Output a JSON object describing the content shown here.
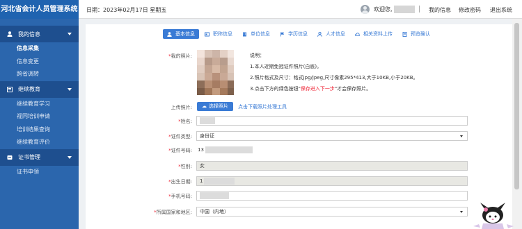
{
  "header": {
    "app_title": "河北省会计人员管理系统",
    "date_label": "日期：2023年02月17日 星期五",
    "welcome": "欢迎您,",
    "links": {
      "my_info": "我的信息",
      "change_password": "修改密码",
      "logout": "退出系统"
    }
  },
  "sidebar": {
    "groups": [
      {
        "label": "我的信息",
        "items": [
          "信息采集",
          "信息变更",
          "跨省调转"
        ]
      },
      {
        "label": "继续教育",
        "items": [
          "继续教育学习",
          "视同培训申请",
          "培训结果查询",
          "继续教育评价"
        ]
      },
      {
        "label": "证书管理",
        "items": [
          "证书申领"
        ]
      }
    ],
    "active_item": "信息采集"
  },
  "tabs": [
    "基本信息",
    "职称信息",
    "单位信息",
    "学历信息",
    "人才信息",
    "相关资料上传",
    "预览确认"
  ],
  "form": {
    "required_mark": "*",
    "photo_label": "我的照片:",
    "notes": {
      "title": "说明：",
      "line1": "1.本人近期免冠证件照片(白底)。",
      "line2": "2.照片格式及尺寸：格式jpg/jpeg,尺寸像素295*413,大于10KB,小于20KB。",
      "line3_pre": "3.点击下方的绿色按钮\"",
      "line3_hl": "保存进入下一步",
      "line3_post": "\"才会保存照片。"
    },
    "upload_label": "上传照片:",
    "upload_button": "选择照片",
    "download_link": "点击下载照片处理工具",
    "name_label": "姓名:",
    "id_type_label": "证件类型:",
    "id_type_value": "身份证",
    "id_number_label": "证件号码:",
    "id_number_prefix": "13",
    "gender_label": "性别:",
    "gender_value": "女",
    "birth_label": "出生日期:",
    "birth_prefix": "1",
    "phone_label": "手机号码:",
    "region_label": "所属国家和地区:",
    "region_value": "中国（内地）"
  },
  "colors": {
    "brand": "#1f63b0",
    "sidebar": "#2b66ad",
    "accent": "#3a7bd5",
    "required": "#e23"
  }
}
